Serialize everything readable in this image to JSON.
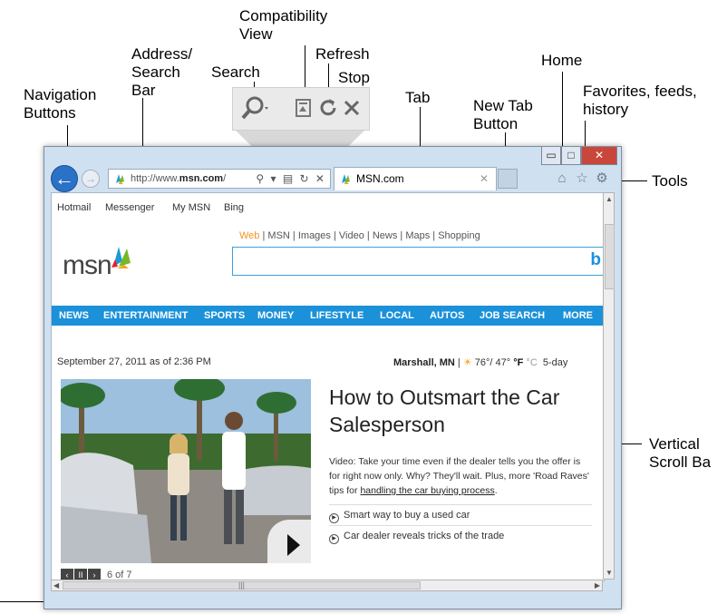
{
  "callouts": {
    "compat_view": "Compatibility\nView",
    "address": "Address/\nSearch\nBar",
    "search": "Search",
    "refresh": "Refresh",
    "stop": "Stop",
    "home": "Home",
    "navigation": "Navigation\nButtons",
    "favorites": "Favorites, feeds,\nhistory",
    "tab": "Tab",
    "new_tab": "New Tab\nButton",
    "tools": "Tools",
    "vscroll": "Vertical\nScroll Ba"
  },
  "browser": {
    "window_buttons": {
      "minimize": "▭",
      "maximize": "□",
      "close": "✕"
    },
    "address_url_prefix": "http://www.",
    "address_url_domain": "msn.com",
    "address_url_suffix": "/",
    "tab_label": "MSN.com",
    "tab_close": "✕",
    "icons": [
      "back-arrow-icon",
      "forward-arrow-icon",
      "search-icon",
      "compatibility-view-icon",
      "refresh-icon",
      "stop-icon",
      "home-icon",
      "favorites-star-icon",
      "tools-gear-icon"
    ]
  },
  "msn": {
    "top_links": [
      "Hotmail",
      "Messenger",
      "My MSN",
      "Bing"
    ],
    "search_tabs": [
      "Web",
      "MSN",
      "Images",
      "Video",
      "News",
      "Maps",
      "Shopping"
    ],
    "logo": "msn",
    "nav": [
      "NEWS",
      "ENTERTAINMENT",
      "SPORTS",
      "MONEY",
      "LIFESTYLE",
      "LOCAL",
      "AUTOS",
      "JOB SEARCH",
      "MORE"
    ],
    "date": "September 27, 2011 as of 2:36 PM",
    "location": "Marshall, MN",
    "temps": "76°/ 47°",
    "unit_f": "°F",
    "unit_c": "°C",
    "forecast": "5-day",
    "headline": "How to Outsmart the Car Salesperson",
    "blurb": "Video: Take your time even if the dealer tells you the offer is for right now only. Why? They'll wait. Plus, more 'Road Raves' tips for",
    "blurb_link": "handling the car buying process",
    "related": [
      "Smart way to buy a used car",
      "Car dealer reveals tricks of the trade"
    ],
    "slide_counter": "6 of 7"
  }
}
